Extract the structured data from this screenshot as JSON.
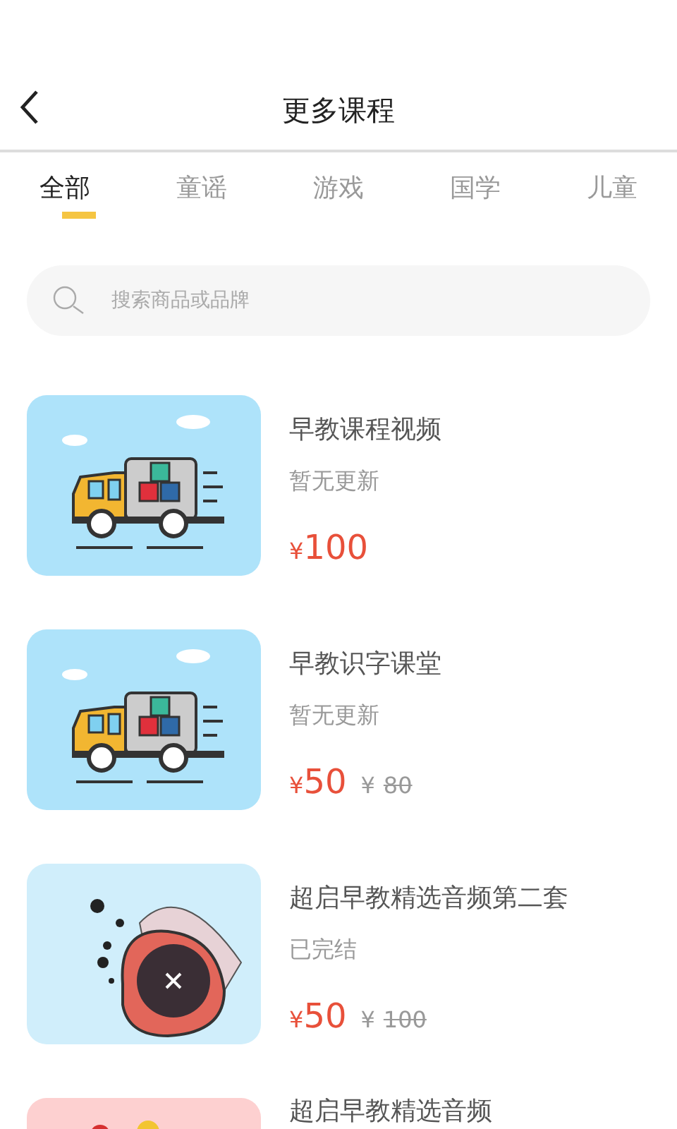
{
  "header": {
    "title": "更多课程"
  },
  "tabs": [
    {
      "label": "全部",
      "selected": true
    },
    {
      "label": "童谣",
      "selected": false
    },
    {
      "label": "游戏",
      "selected": false
    },
    {
      "label": "国学",
      "selected": false
    },
    {
      "label": "儿童",
      "selected": false
    }
  ],
  "search": {
    "placeholder": "搜索商品或品牌"
  },
  "courses": [
    {
      "image": {
        "kind": "truck"
      },
      "title": "早教课程视频",
      "status": "暂无更新",
      "price": {
        "currency": "¥",
        "amount": "100"
      }
    },
    {
      "image": {
        "kind": "truck"
      },
      "title": "早教识字课堂",
      "status": "暂无更新",
      "price": {
        "currency": "¥",
        "amount": "50"
      },
      "original_price": {
        "currency": "¥",
        "amount": "80"
      }
    },
    {
      "image": {
        "kind": "fish"
      },
      "title": "超启早教精选音频第二套",
      "status": "已完结",
      "price": {
        "currency": "¥",
        "amount": "50"
      },
      "original_price": {
        "currency": "¥",
        "amount": "100"
      }
    },
    {
      "image": {
        "kind": "pink"
      },
      "title": "超启早教精选音频"
    }
  ]
}
